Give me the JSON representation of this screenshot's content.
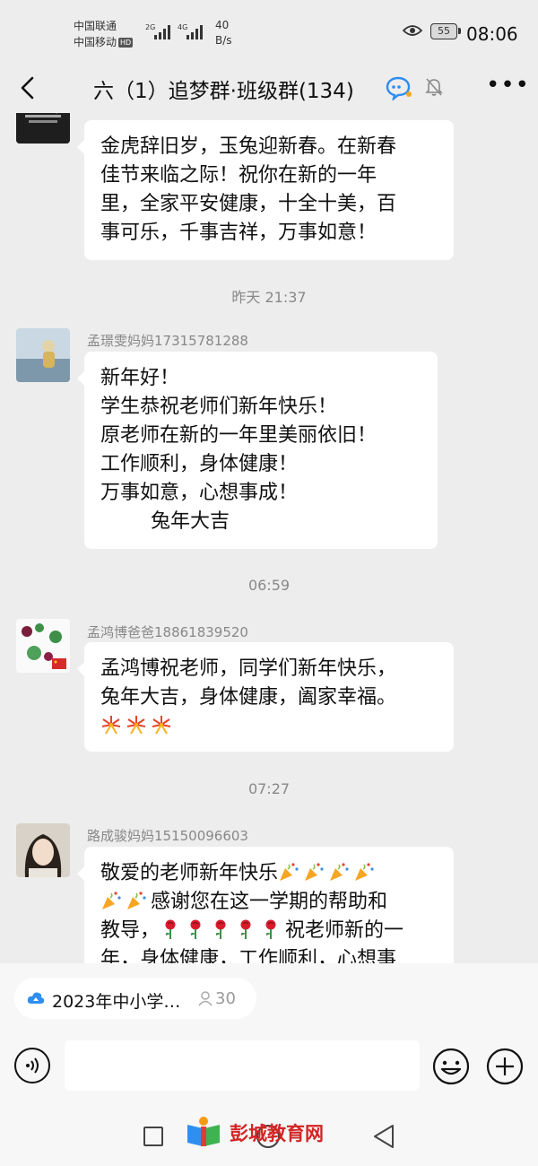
{
  "status_bar": {
    "carrier_1": "中国联通",
    "carrier_2": "中国移动",
    "hd_badge": "HD",
    "net_1": "2G",
    "net_2": "4G",
    "speed_value": "40",
    "speed_unit": "B/s",
    "battery": "55",
    "time": "08:06"
  },
  "header": {
    "title": "六（1）追梦群·班级群(134)"
  },
  "messages": [
    {
      "sender": "",
      "lines": [
        "金虎辞旧岁，玉兔迎新春。在新春",
        "佳节来临之际！祝你在新的一年",
        "里，全家平安健康，十全十美，百",
        "事可乐，千事吉祥，万事如意！"
      ]
    },
    {
      "timestamp": "昨天 21:37",
      "sender": "孟璟雯妈妈17315781288",
      "lines": [
        "新年好！",
        "学生恭祝老师们新年快乐！",
        "原老师在新的一年里美丽依旧！",
        "工作顺利，身体健康！",
        "万事如意，心想事成！",
        "        兔年大吉"
      ]
    },
    {
      "timestamp": "06:59",
      "sender": "孟鸿博爸爸18861839520",
      "lines": [
        "孟鸿博祝老师，同学们新年快乐，",
        "兔年大吉，身体健康，阖家幸福。"
      ],
      "emoji_line": [
        "fireworks-icon",
        "fireworks-icon",
        "fireworks-icon"
      ]
    },
    {
      "timestamp": "07:27",
      "sender": "路成骏妈妈15150096603",
      "line1": "敬爱的老师新年快乐",
      "line2_text": "感谢您在这一学期的帮助和",
      "line3_text_a": "教导，",
      "line3_text_b": "祝老师新的一",
      "line4": "年，身体健康，工作顺利，心想事"
    }
  ],
  "bottom": {
    "pinned_text": "2023年中小学…",
    "pinned_count": "30",
    "watermark": "彭城教育网"
  },
  "colors": {
    "background": "#ededed",
    "bubble": "#ffffff",
    "meta_text": "#888888",
    "watermark_red": "#d42424"
  }
}
